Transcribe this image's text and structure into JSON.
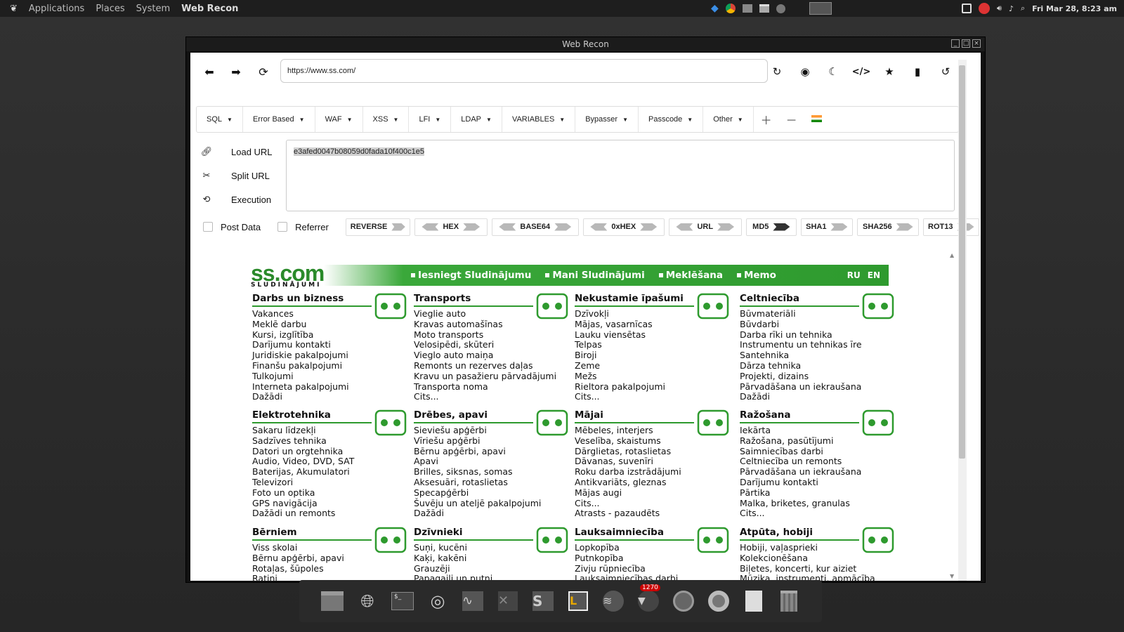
{
  "panel": {
    "menus": [
      "Applications",
      "Places",
      "System"
    ],
    "active_app": "Web Recon",
    "datetime": "Fri Mar 28,  8:23 am"
  },
  "window": {
    "title": "Web Recon"
  },
  "browser": {
    "url": "https://www.ss.com/"
  },
  "toolbar": {
    "menus": [
      "SQL",
      "Error Based",
      "WAF",
      "XSS",
      "LFI",
      "LDAP",
      "VARIABLES",
      "Bypasser",
      "Passcode",
      "Other"
    ]
  },
  "sidepanel": {
    "load_url": "Load URL",
    "split_url": "Split URL",
    "execution": "Execution"
  },
  "editor": {
    "content": "e3afed0047b08059d0fada10f400c1e5"
  },
  "options": {
    "post_data": "Post Data",
    "referrer": "Referrer",
    "buttons": [
      "REVERSE",
      "HEX",
      "BASE64",
      "0xHEX",
      "URL",
      "MD5",
      "SHA1",
      "SHA256",
      "ROT13"
    ]
  },
  "site": {
    "logo": "ss.com",
    "logo_sub": "SLUDINĀJUMI",
    "nav": [
      "Iesniegt Sludinājumu",
      "Mani Sludinājumi",
      "Meklēšana",
      "Memo"
    ],
    "lang": [
      "RU",
      "EN"
    ],
    "categories": [
      {
        "title": "Darbs un bizness",
        "icon": "notepad-pencil-icon",
        "items": [
          "Vakances",
          "Meklē darbu",
          "Kursi, izglītība",
          "Darījumu kontakti",
          "Juridiskie pakalpojumi",
          "Finanšu pakalpojumi",
          "Tulkojumi",
          "Interneta pakalpojumi",
          "Dažādi"
        ]
      },
      {
        "title": "Transports",
        "icon": "car-icon",
        "items": [
          "Vieglie auto",
          "Kravas automašīnas",
          "Moto transports",
          "Velosipēdi, skūteri",
          "Vieglo auto maiņa",
          "Remonts un rezerves daļas",
          "Kravu un pasažieru pārvadājumi",
          "Transporta noma",
          "Cits..."
        ]
      },
      {
        "title": "Nekustamie īpašumi",
        "icon": "house-icon",
        "items": [
          "Dzīvokļi",
          "Mājas, vasarnīcas",
          "Lauku viensētas",
          "Telpas",
          "Biroji",
          "Zeme",
          "Mežs",
          "Rieltora pakalpojumi",
          "Cits..."
        ]
      },
      {
        "title": "Celtniecība",
        "icon": "hard-hat-icon",
        "items": [
          "Būvmateriāli",
          "Būvdarbi",
          "Darba rīki un tehnika",
          "Instrumentu un tehnikas īre",
          "Santehnika",
          "Dārza tehnika",
          "Projekti, dizains",
          "Pārvadāšana un iekraušana",
          "Dažādi"
        ]
      },
      {
        "title": "Elektrotehnika",
        "icon": "monitor-icon",
        "items": [
          "Sakaru līdzekļi",
          "Sadzīves tehnika",
          "Datori un orgtehnika",
          "Audio, Video, DVD, SAT",
          "Baterijas, Akumulatori",
          "Televizori",
          "Foto un optika",
          "GPS navigācija",
          "Dažādi un remonts"
        ]
      },
      {
        "title": "Drēbes, apavi",
        "icon": "hanger-icon",
        "items": [
          "Sieviešu apģērbi",
          "Vīriešu apģērbi",
          "Bērnu apģērbi, apavi",
          "Apavi",
          "Brilles, siksnas, somas",
          "Aksesuāri, rotaslietas",
          "Specapģērbi",
          "Šuvēju un ateljē pakalpojumi",
          "Dažādi"
        ]
      },
      {
        "title": "Mājai",
        "icon": "armchair-icon",
        "items": [
          "Mēbeles, interjers",
          "Veselība, skaistums",
          "Dārglietas, rotaslietas",
          "Dāvanas, suvenīri",
          "Roku darba izstrādājumi",
          "Antikvariāts, gleznas",
          "Mājas augi",
          "Cits...",
          "Atrasts - pazaudēts"
        ]
      },
      {
        "title": "Ražošana",
        "icon": "factory-icon",
        "items": [
          "Iekārta",
          "Ražošana, pasūtījumi",
          "Saimniecības darbi",
          "Celtniecība un remonts",
          "Pārvadāšana un iekraušana",
          "Darījumu kontakti",
          "Pārtika",
          "Malka, briketes, granulas",
          "Cits..."
        ]
      },
      {
        "title": "Bērniem",
        "icon": "teddy-bear-icon",
        "items": [
          "Viss skolai",
          "Bērnu apģērbi, apavi",
          "Rotaļas, šūpoles",
          "Ratiņi"
        ]
      },
      {
        "title": "Dzīvnieki",
        "icon": "cat-icon",
        "items": [
          "Suņi, kucēni",
          "Kaķi, kakēni",
          "Grauzēji",
          "Papagaiļi un putni"
        ]
      },
      {
        "title": "Lauksaimniecība",
        "icon": "tractor-icon",
        "items": [
          "Lopkopība",
          "Putnkopība",
          "Zivju rūpniecība",
          "Lauksaimniecības darbi"
        ]
      },
      {
        "title": "Atpūta, hobiji",
        "icon": "palm-tree-icon",
        "items": [
          "Hobiji, vaļasprieki",
          "Kolekcionēšana",
          "Biļetes, koncerti, kur aiziet",
          "Mūzika, instrumenti, apmācība"
        ]
      }
    ]
  },
  "dock": {
    "badge": "1270"
  }
}
